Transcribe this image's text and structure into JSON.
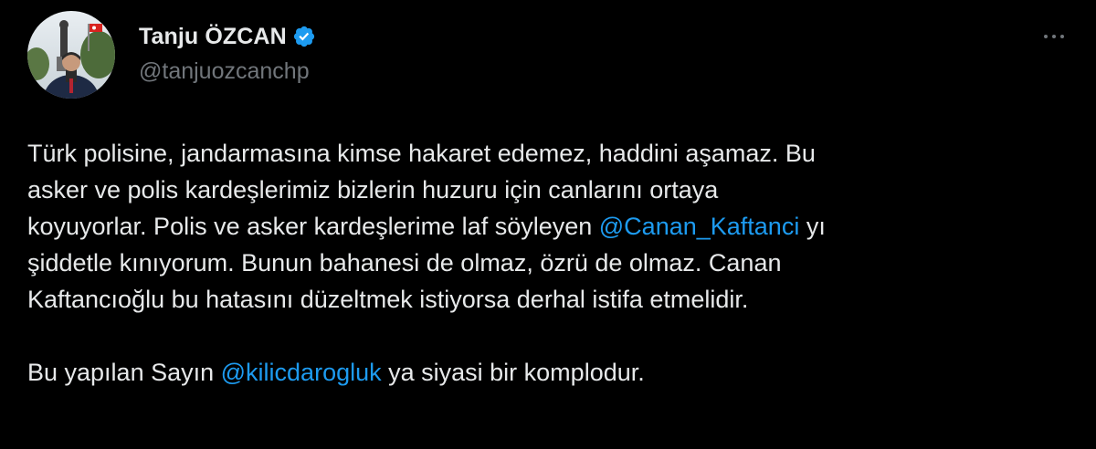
{
  "author": {
    "display_name": "Tanju ÖZCAN",
    "handle": "@tanjuozcanchp",
    "verified_icon": "verified-badge-icon",
    "avatar": "profile-photo"
  },
  "more_icon": "more-options-icon",
  "tweet": {
    "p1": {
      "l1": "Türk polisine, jandarmasına kimse hakaret edemez, haddini aşamaz. Bu",
      "l2": "asker ve polis kardeşlerimiz bizlerin huzuru için canlarını ortaya",
      "l3_before": "koyuyorlar. Polis ve asker kardeşlerime laf söyleyen ",
      "l3_mention": "@Canan_Kaftanci",
      "l3_after": " yı",
      "l4": "şiddetle kınıyorum. Bunun bahanesi de olmaz, özrü de olmaz. Canan",
      "l5": "Kaftancıoğlu bu hatasını düzeltmek istiyorsa derhal istifa etmelidir."
    },
    "p2": {
      "before": "Bu yapılan Sayın ",
      "mention": "@kilicdarogluk",
      "after": " ya siyasi bir komplodur."
    }
  },
  "colors": {
    "background": "#000000",
    "text": "#e7e9ea",
    "secondary": "#71767b",
    "link": "#1d9bf0",
    "verified": "#1d9bf0"
  }
}
